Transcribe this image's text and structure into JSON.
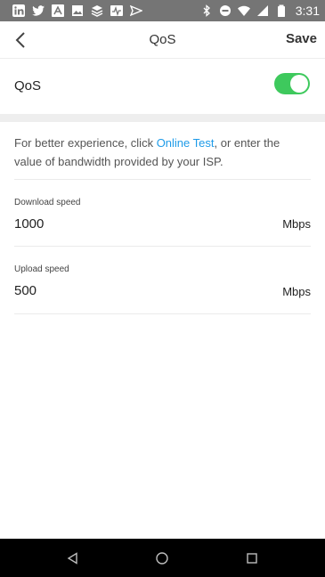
{
  "status_bar": {
    "time": "3:31",
    "left_icons": [
      "linkedin-icon",
      "twitter-icon",
      "app-icon",
      "image-icon",
      "layers-icon",
      "activity-icon",
      "send-icon"
    ],
    "right_icons": [
      "bluetooth-icon",
      "dnd-icon",
      "wifi-icon",
      "signal-icon",
      "battery-icon"
    ]
  },
  "app_bar": {
    "title": "QoS",
    "save_label": "Save"
  },
  "qos": {
    "label": "QoS",
    "enabled": true
  },
  "hint": {
    "prefix": "For better experience, click ",
    "link": "Online Test",
    "suffix": ", or enter the value of bandwidth provided by your ISP."
  },
  "download": {
    "label": "Download speed",
    "value": "1000",
    "unit": "Mbps"
  },
  "upload": {
    "label": "Upload speed",
    "value": "500",
    "unit": "Mbps"
  },
  "colors": {
    "toggle_on": "#3ec95d",
    "link": "#1e9be8",
    "status_bar": "#757575",
    "nav_bar": "#000000"
  }
}
